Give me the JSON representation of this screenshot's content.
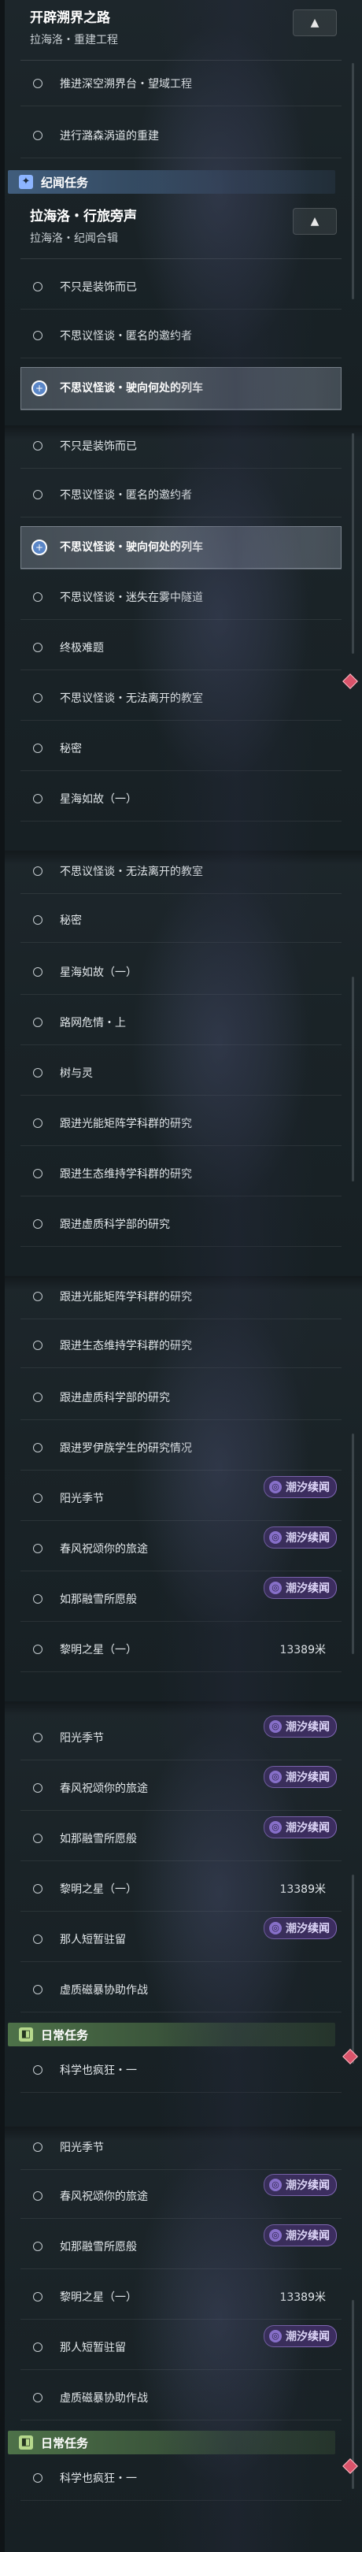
{
  "panel1": {
    "quest": {
      "title": "开辟溯界之路",
      "subtitle": "拉海洛・重建工程"
    },
    "items": [
      "推进深空溯界台・望域工程",
      "进行潞森涡道的重建"
    ],
    "section": "纪闻任务",
    "quest2": {
      "title": "拉海洛・行旅旁声",
      "subtitle": "拉海洛・纪闻合辑"
    },
    "items2": [
      {
        "label": "不只是装饰而已",
        "active": false
      },
      {
        "label": "不思议怪谈・匿名的邀约者",
        "active": false
      },
      {
        "label": "不思议怪谈・驶向何处的列车",
        "active": true
      }
    ]
  },
  "panel2": {
    "items": [
      {
        "label": "不只是装饰而已",
        "active": false
      },
      {
        "label": "不思议怪谈・匿名的邀约者",
        "active": false
      },
      {
        "label": "不思议怪谈・驶向何处的列车",
        "active": true
      },
      {
        "label": "不思议怪谈・迷失在雾中隧道",
        "active": false
      },
      {
        "label": "终极难题",
        "active": false
      },
      {
        "label": "不思议怪谈・无法离开的教室",
        "active": false
      },
      {
        "label": "秘密",
        "active": false
      },
      {
        "label": "星海如故（一）",
        "active": false
      }
    ]
  },
  "panel3": {
    "items": [
      "不思议怪谈・无法离开的教室",
      "秘密",
      "星海如故（一）",
      "路网危情・上",
      "树与灵",
      "跟进光能矩阵学科群的研究",
      "跟进生态维持学科群的研究",
      "跟进虚质科学部的研究"
    ]
  },
  "panel4": {
    "items": [
      {
        "label": "跟进光能矩阵学科群的研究"
      },
      {
        "label": "跟进生态维持学科群的研究"
      },
      {
        "label": "跟进虚质科学部的研究"
      },
      {
        "label": "跟进罗伊族学生的研究情况"
      },
      {
        "label": "阳光季节",
        "tag": "潮汐续闻"
      },
      {
        "label": "春风祝颂你的旅途",
        "tag": "潮汐续闻"
      },
      {
        "label": "如那融雪所愿般",
        "tag": "潮汐续闻"
      },
      {
        "label": "黎明之星（一）",
        "distance": "13389米"
      }
    ]
  },
  "panel5": {
    "items": [
      {
        "label": "阳光季节",
        "tag": "潮汐续闻"
      },
      {
        "label": "春风祝颂你的旅途",
        "tag": "潮汐续闻"
      },
      {
        "label": "如那融雪所愿般",
        "tag": "潮汐续闻"
      },
      {
        "label": "黎明之星（一）",
        "distance": "13389米"
      },
      {
        "label": "那人短暂驻留",
        "tag": "潮汐续闻"
      },
      {
        "label": "虚质磁暴协助作战"
      }
    ],
    "section": "日常任务",
    "daily": [
      "科学也疯狂・一"
    ]
  },
  "panel6": {
    "items": [
      {
        "label": "阳光季节"
      },
      {
        "label": "春风祝颂你的旅途",
        "tag": "潮汐续闻"
      },
      {
        "label": "如那融雪所愿般",
        "tag": "潮汐续闻"
      },
      {
        "label": "黎明之星（一）",
        "distance": "13389米"
      },
      {
        "label": "那人短暂驻留",
        "tag": "潮汐续闻"
      },
      {
        "label": "虚质磁暴协助作战"
      }
    ],
    "section": "日常任务",
    "daily": [
      "科学也疯狂・一"
    ]
  },
  "icons": {
    "collapse": "chevron-up-icon",
    "tag": "tide-icon",
    "section": "book-icon",
    "marker": "diamond-marker-icon",
    "circle": "quest-circle-icon",
    "active": "track-plus-icon"
  },
  "colors": {
    "section_blue": "#47678b",
    "section_green": "#537a4c",
    "tag_purple": "#3e2e62",
    "marker_red": "#d9536a"
  }
}
